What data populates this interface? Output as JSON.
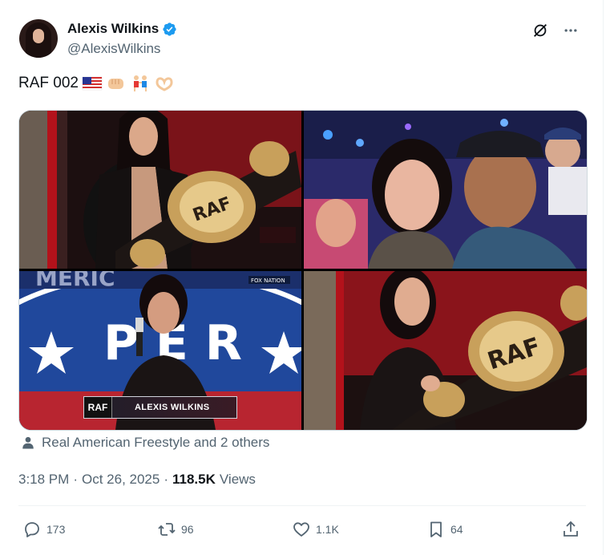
{
  "author": {
    "name": "Alexis Wilkins",
    "handle": "@AlexisWilkins",
    "verified": true
  },
  "icons": {
    "verified": "verified-badge-icon",
    "grok": "grok-icon",
    "more": "more-icon",
    "person": "person-icon",
    "reply": "reply-icon",
    "retweet": "retweet-icon",
    "like": "like-icon",
    "bookmark": "bookmark-icon",
    "share": "share-icon"
  },
  "tweet": {
    "text": "RAF 002",
    "emojis": [
      "us-flag",
      "oncoming-fist",
      "people-wrestling",
      "heart-hands"
    ]
  },
  "media": {
    "images": [
      {
        "subject": "woman holding RAF championship belt"
      },
      {
        "subject": "selfie of woman and man in arena"
      },
      {
        "subject": "woman singing into microphone on stage",
        "lower_third": {
          "logo": "RAF",
          "name": "ALEXIS WILKINS"
        },
        "watermark": "FOX NATION"
      },
      {
        "subject": "woman holding RAF belt in arena"
      }
    ],
    "belt_text": "RAF"
  },
  "tagged": "Real American Freestyle and 2 others",
  "meta": {
    "time": "3:18 PM",
    "separator": "·",
    "date": "Oct 26, 2025",
    "views_count": "118.5K",
    "views_label": "Views"
  },
  "actions": {
    "replies": "173",
    "reposts": "96",
    "likes": "1.1K",
    "bookmarks": "64"
  },
  "colors": {
    "text": "#0f1419",
    "secondary": "#536471",
    "verified": "#1d9bf0",
    "border": "#eff3f4"
  }
}
